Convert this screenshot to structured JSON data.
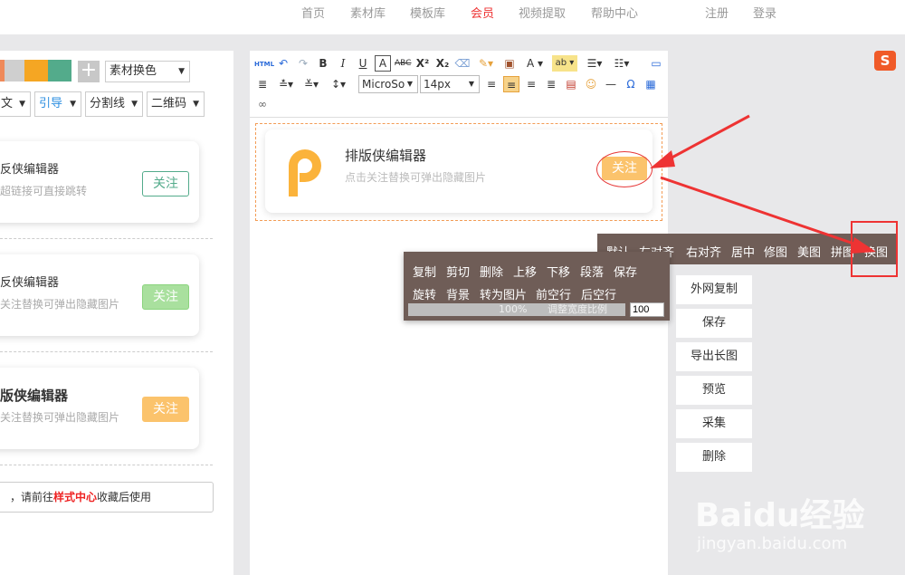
{
  "nav": [
    "首页",
    "素材库",
    "模板库",
    "会员",
    "视频提取",
    "帮助中心",
    "注册",
    "登录"
  ],
  "left": {
    "color_select": "素材换色",
    "filters": [
      "文",
      "引导",
      "分割线",
      "二维码"
    ],
    "cards": [
      {
        "title": "反侠编辑器",
        "sub": "超链接可直接跳转",
        "follow": "关注"
      },
      {
        "title": "反侠编辑器",
        "sub": "关注替换可弹出隐藏图片",
        "follow": "关注"
      },
      {
        "title": "版侠编辑器",
        "sub": "关注替换可弹出隐藏图片",
        "follow": "关注"
      }
    ],
    "tip_prefix": "，请前往",
    "tip_link": "样式中心",
    "tip_suffix": "收藏后使用"
  },
  "toolbar": {
    "font_family": "MicroSo",
    "font_size": "14px"
  },
  "editor": {
    "card_title": "排版侠编辑器",
    "card_sub": "点击关注替换可弹出隐藏图片",
    "card_follow": "关注"
  },
  "align_bar": [
    "默认",
    "左对齐",
    "右对齐",
    "居中",
    "修图",
    "美图",
    "拼图",
    "换图"
  ],
  "context_menu": {
    "row1": [
      "复制",
      "剪切",
      "删除",
      "上移",
      "下移",
      "段落",
      "保存"
    ],
    "row2": [
      "旋转",
      "背景",
      "转为图片",
      "前空行",
      "后空行"
    ],
    "ratio_percent": "100%",
    "ratio_label": "调整宽度比例",
    "ratio_input": "100"
  },
  "side_buttons": [
    "外网复制",
    "保存",
    "导出长图",
    "预览",
    "采集",
    "删除"
  ],
  "watermark": {
    "main": "Baidu经验",
    "sub": "jingyan.baidu.com"
  },
  "sogou_letter": "S",
  "colors": {
    "accent_red": "#e33333",
    "follow_orange": "#fbc36c",
    "menu_bg": "#6f5d57",
    "swatch_colors": [
      "#ef8a5a",
      "#cfcfcf",
      "#f5a623",
      "#53ab8b"
    ]
  }
}
